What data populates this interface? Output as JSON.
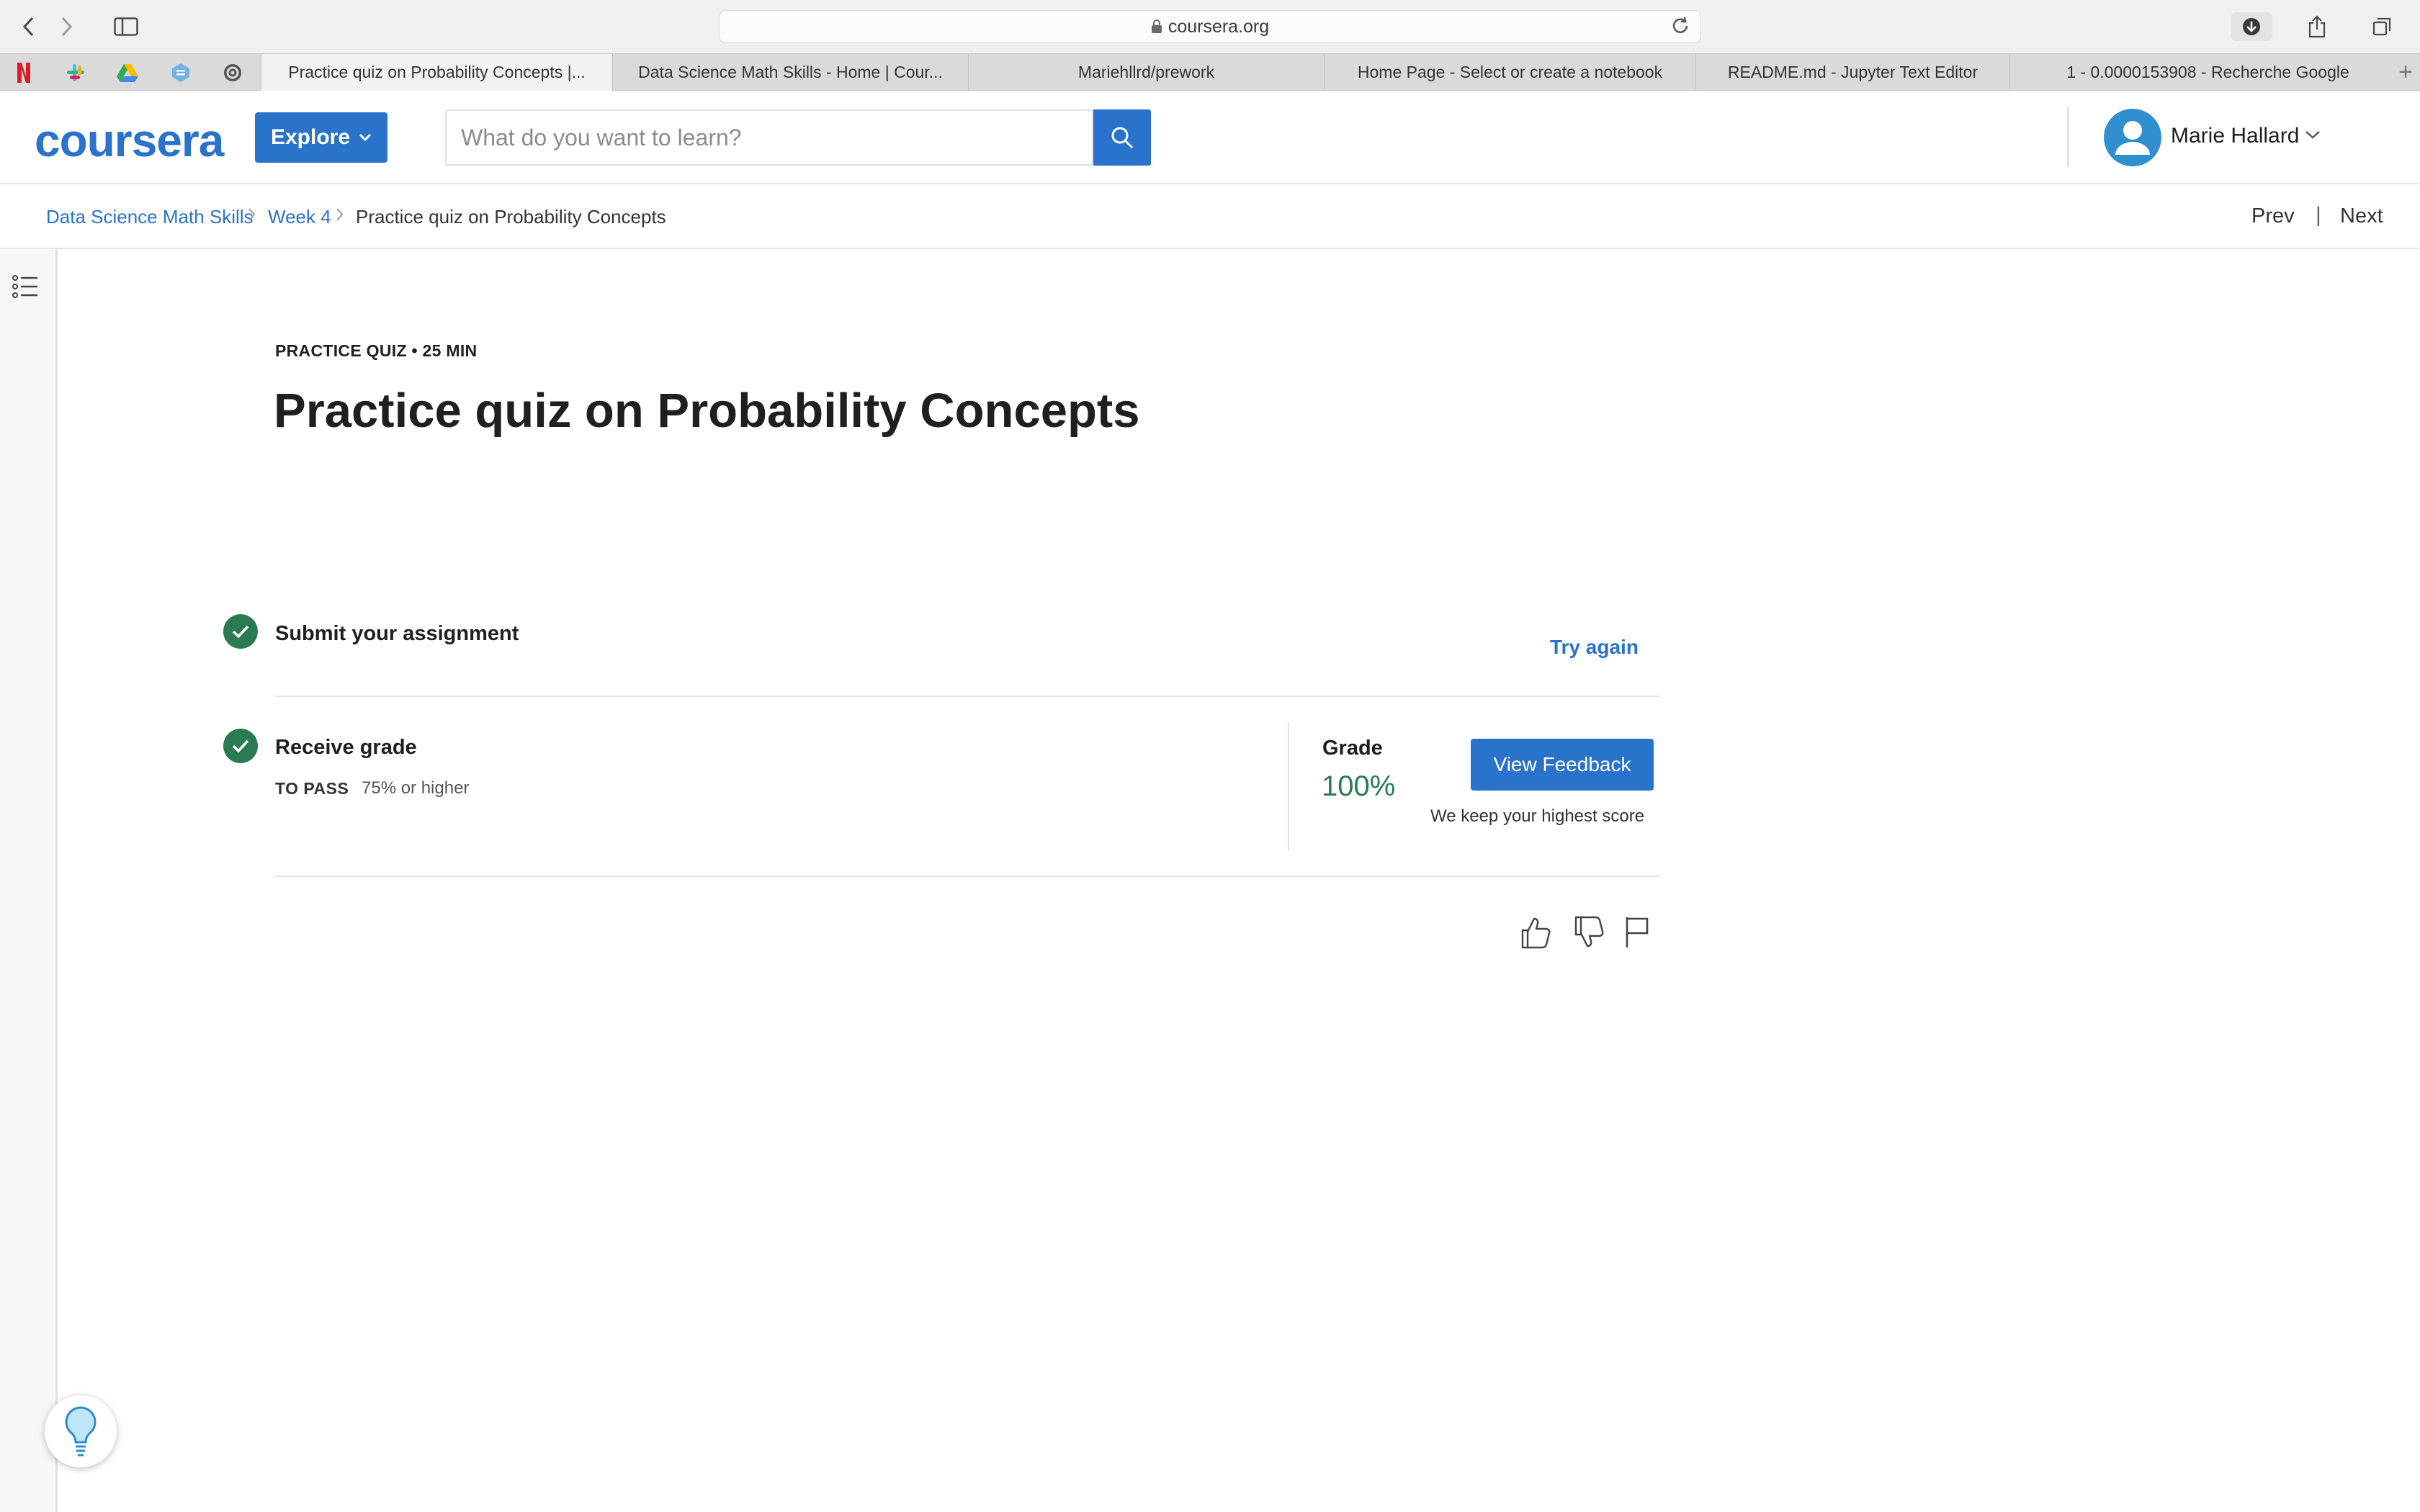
{
  "browser": {
    "url": "coursera.org",
    "tabs": [
      {
        "label": "Practice quiz on Probability Concepts |...",
        "active": true
      },
      {
        "label": "Data Science Math Skills - Home | Cour...",
        "active": false
      },
      {
        "label": "Mariehllrd/prework",
        "active": false
      },
      {
        "label": "Home Page - Select or create a notebook",
        "active": false
      },
      {
        "label": "README.md - Jupyter Text Editor",
        "active": false
      },
      {
        "label": "1 - 0.0000153908 - Recherche Google",
        "active": false
      }
    ],
    "new_tab": "+"
  },
  "header": {
    "logo": "coursera",
    "explore_label": "Explore",
    "search_placeholder": "What do you want to learn?",
    "user_name": "Marie Hallard"
  },
  "breadcrumb": {
    "items": [
      "Data Science Math Skills",
      "Week 4",
      "Practice quiz on Probability Concepts"
    ],
    "prev": "Prev",
    "divider": "|",
    "next": "Next"
  },
  "quiz": {
    "eyebrow": "PRACTICE QUIZ • 25 MIN",
    "title": "Practice quiz on Probability Concepts",
    "submit_label": "Submit your assignment",
    "try_again": "Try again",
    "receive_label": "Receive grade",
    "to_pass_key": "TO PASS",
    "to_pass_value": "75% or higher",
    "grade_label": "Grade",
    "grade_value": "100%",
    "view_feedback": "View Feedback",
    "keep_note": "We keep your highest score"
  },
  "colors": {
    "accent": "#2a73cc",
    "success": "#2a7a52"
  },
  "icons": [
    "back-icon",
    "forward-icon",
    "sidebar-icon",
    "lock-icon",
    "reload-icon",
    "download-icon",
    "share-icon",
    "tabs-overview-icon",
    "search-icon",
    "user-icon",
    "chevron-down-icon",
    "outline-list-icon",
    "checkmark-icon",
    "thumbs-up-icon",
    "thumbs-down-icon",
    "flag-icon",
    "lightbulb-icon"
  ]
}
